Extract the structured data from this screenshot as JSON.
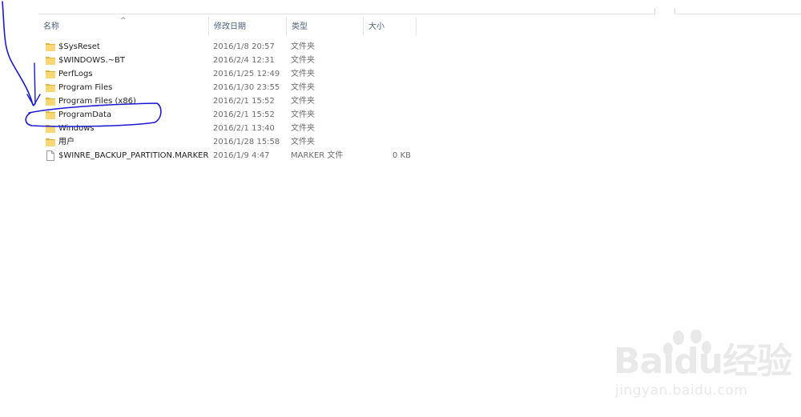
{
  "columns": {
    "name": "名称",
    "date": "修改日期",
    "type": "类型",
    "size": "大小"
  },
  "sort_indicator": "^",
  "files": [
    {
      "name": "$SysReset",
      "date": "2016/1/8 20:57",
      "type": "文件夹",
      "size": "",
      "icon": "folder-icon"
    },
    {
      "name": "$WINDOWS.~BT",
      "date": "2016/2/4 12:31",
      "type": "文件夹",
      "size": "",
      "icon": "folder-icon"
    },
    {
      "name": "PerfLogs",
      "date": "2016/1/25 12:49",
      "type": "文件夹",
      "size": "",
      "icon": "folder-icon"
    },
    {
      "name": "Program Files",
      "date": "2016/1/30 23:55",
      "type": "文件夹",
      "size": "",
      "icon": "folder-icon"
    },
    {
      "name": "Program Files (x86)",
      "date": "2016/2/1 15:52",
      "type": "文件夹",
      "size": "",
      "icon": "folder-icon"
    },
    {
      "name": "ProgramData",
      "date": "2016/2/1 15:52",
      "type": "文件夹",
      "size": "",
      "icon": "folder-icon"
    },
    {
      "name": "Windows",
      "date": "2016/2/1 13:40",
      "type": "文件夹",
      "size": "",
      "icon": "folder-icon"
    },
    {
      "name": "用户",
      "date": "2016/1/28 15:58",
      "type": "文件夹",
      "size": "",
      "icon": "folder-icon"
    },
    {
      "name": "$WINRE_BACKUP_PARTITION.MARKER",
      "date": "2016/1/9 4:47",
      "type": "MARKER 文件",
      "size": "0 KB",
      "icon": "file-icon"
    }
  ],
  "watermark": {
    "brand": "Baidu经验",
    "url": "jingyan.baidu.com"
  },
  "colors": {
    "folder": "#f8d775",
    "folder_dark": "#e2b43c",
    "annotation": "#1a1ad6",
    "header_text": "#4c607a"
  }
}
